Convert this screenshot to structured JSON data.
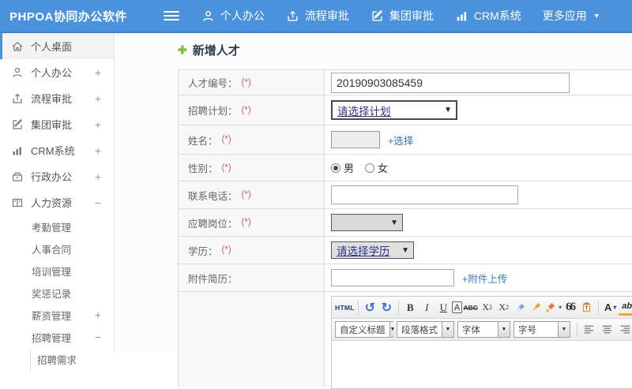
{
  "topbar": {
    "logo": "PHPOA协同办公软件",
    "nav": [
      {
        "label": "个人办公",
        "icon": "person-icon"
      },
      {
        "label": "流程审批",
        "icon": "process-icon"
      },
      {
        "label": "集团审批",
        "icon": "edit-icon"
      },
      {
        "label": "CRM系统",
        "icon": "chart-icon"
      },
      {
        "label": "更多应用",
        "icon": "caret-down-icon"
      }
    ]
  },
  "icons": {
    "caret_down": "▼",
    "combo_arrow": "▼",
    "select_arrow": "▼",
    "plus_green": "✚",
    "undo": "↺",
    "redo": "↻"
  },
  "sidebar": {
    "items": [
      {
        "label": "个人桌面",
        "expand": ""
      },
      {
        "label": "个人办公",
        "expand": "+"
      },
      {
        "label": "流程审批",
        "expand": "+"
      },
      {
        "label": "集团审批",
        "expand": "+"
      },
      {
        "label": "CRM系统",
        "expand": "+"
      },
      {
        "label": "行政办公",
        "expand": "+"
      },
      {
        "label": "人力资源",
        "expand": "−"
      },
      {
        "label": "考勤管理",
        "expand": ""
      },
      {
        "label": "人事合同",
        "expand": ""
      },
      {
        "label": "培训管理",
        "expand": ""
      },
      {
        "label": "奖惩记录",
        "expand": ""
      },
      {
        "label": "薪资管理",
        "expand": "+"
      },
      {
        "label": "招聘管理",
        "expand": "−"
      },
      {
        "label": "招聘需求",
        "expand": ""
      }
    ]
  },
  "main": {
    "title": "新增人才",
    "form": {
      "rows": [
        {
          "label": "人才编号：",
          "required": "(*)",
          "value": "20190903085459"
        },
        {
          "label": "招聘计划：",
          "required": "(*)",
          "value": "请选择计划"
        },
        {
          "label": "姓名：",
          "required": "(*)",
          "link": "+选择"
        },
        {
          "label": "性别：",
          "required": "(*)",
          "options": [
            "男",
            "女"
          ]
        },
        {
          "label": "联系电话：",
          "required": "(*)"
        },
        {
          "label": "应聘岗位：",
          "required": "(*)",
          "value": ""
        },
        {
          "label": "学历：",
          "required": "(*)",
          "value": "请选择学历"
        },
        {
          "label": "附件简历：",
          "required": "",
          "link": "+附件上传"
        },
        {
          "label": ""
        }
      ]
    }
  },
  "editor": {
    "source_label": "HTML",
    "bold": "B",
    "italic": "I",
    "underline": "U",
    "char_border": "A",
    "strike": "ABC",
    "sup_base": "X",
    "sup_script": "2",
    "sub_base": "X",
    "sub_script": "2",
    "quote": "66",
    "font_color_letter": "A",
    "highlight_letters": "ab",
    "selects": [
      {
        "label": "自定义标题"
      },
      {
        "label": "段落格式"
      },
      {
        "label": "字体"
      },
      {
        "label": "字号"
      }
    ]
  }
}
